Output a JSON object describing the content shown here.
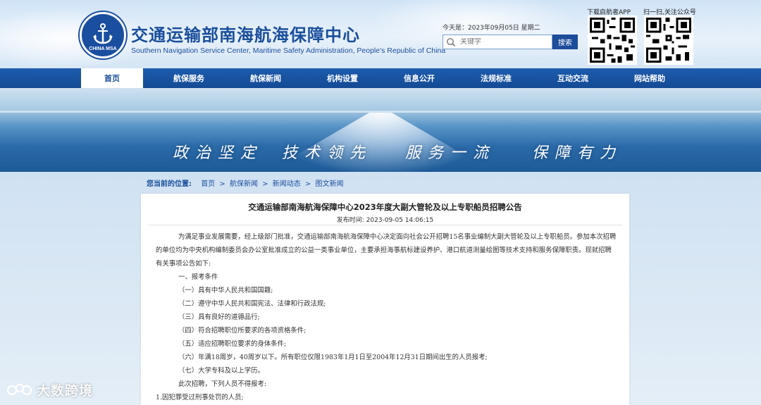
{
  "header": {
    "site_title": "交通运输部南海航海保障中心",
    "site_subtitle": "Southern Navigation Service Center, Maritime Safety Administration, People's Republic of China",
    "logo_text": "CHINA MSA",
    "date_line": "今天是：2023年09月05日 星期二",
    "search": {
      "placeholder": "关键字",
      "button_label": "搜索"
    },
    "qr_app_label": "下载启航者APP",
    "qr_wechat_label": "扫一扫,关注公众号"
  },
  "nav": {
    "items": [
      {
        "label": "首页",
        "active": true
      },
      {
        "label": "航保服务"
      },
      {
        "label": "航保新闻"
      },
      {
        "label": "机构设置"
      },
      {
        "label": "信息公开"
      },
      {
        "label": "法规标准"
      },
      {
        "label": "互动交流"
      },
      {
        "label": "网站帮助"
      }
    ]
  },
  "banner": {
    "slogans": [
      "政治坚定",
      "技术领先",
      "服务一流",
      "保障有力"
    ]
  },
  "breadcrumb": {
    "label": "您当前的位置:",
    "items": [
      "首页",
      "航保新闻",
      "新闻动态",
      "图文新闻"
    ],
    "separator": ">"
  },
  "article": {
    "title": "交通运输部南海航海保障中心2023年度大副大管轮及以上专职船员招聘公告",
    "meta": "发布时间: 2023-09-05 14:06:15",
    "paragraphs": [
      "为满足事业发展需要，经上级部门批准，交通运输部南海航海保障中心决定面向社会公开招聘15名事业编制大副大管轮及以上专职船员。参加本次招聘的单位均为中央机构编制委员会办公室批准成立的公益一类事业单位，主要承担海事航标建设养护、港口航道测量绘图等技术支持和服务保障职责。现就招聘有关事项公告如下:",
      "一、报考条件",
      "（一）具有中华人民共和国国籍;",
      "（二）遵守中华人民共和国宪法、法律和行政法规;",
      "（三）具有良好的道德品行;",
      "（四）符合招聘职位所要求的各项资格条件;",
      "（五）适应招聘职位要求的身体条件;",
      "（六）年满18周岁，40周岁以下。所有职位仅限1983年1月1日至2004年12月31日期间出生的人员报考;",
      "（七）大学专科及以上学历。",
      "此次招聘，下列人员不得报考:",
      "1.因犯罪受过刑事处罚的人员;"
    ]
  },
  "watermark": "大数跨境"
}
